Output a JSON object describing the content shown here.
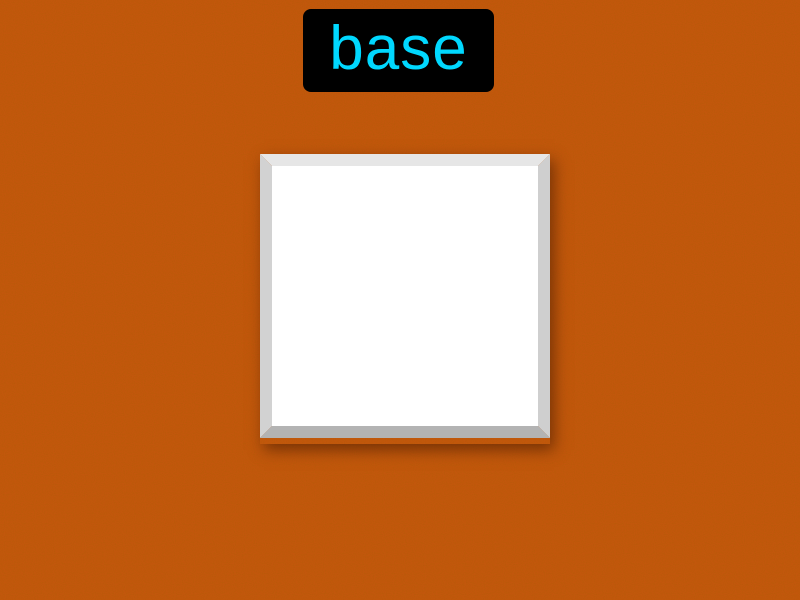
{
  "label": {
    "text": "base",
    "text_color": "#00d8ff",
    "background_color": "#000000"
  },
  "background": {
    "color": "#c2570c",
    "texture": "speckled-noise"
  },
  "tile": {
    "face_color": "#ffffff",
    "bevel_top_color": "#e6e6e6",
    "bevel_left_color": "#d2d2d2",
    "bevel_right_color": "#cfcfcf",
    "bevel_bottom_color": "#b3b3b3"
  }
}
